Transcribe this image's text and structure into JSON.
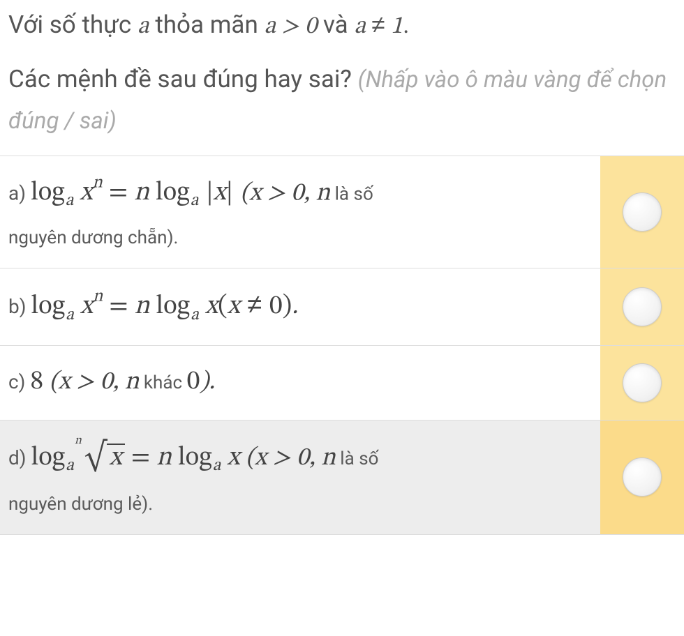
{
  "intro": {
    "pre": "Với số thực ",
    "a": "a",
    "mid": " thỏa mãn ",
    "cond1": "a > 0",
    "and": " và ",
    "cond2_a": "a",
    "cond2_neq": "≠",
    "cond2_one": "1",
    "period": "."
  },
  "sub": {
    "main": "Các mệnh đề sau đúng hay sai? ",
    "hint": "(Nhấp vào ô màu vàng để chọn đúng / sai)"
  },
  "options": {
    "a": {
      "label": "a) ",
      "log": "log",
      "sub": "a",
      "x": "x",
      "sup": "n",
      "eq": " = ",
      "n": "n",
      "log2": " log",
      "sub2": "a",
      "absx": "|x|",
      "open": " (",
      "cond": "x > 0",
      "comma": ", ",
      "nvar": "n",
      "note1": " là số",
      "note2": "nguyên dương chẵn).",
      "close": ""
    },
    "b": {
      "label": "b) ",
      "log": "log",
      "sub": "a",
      "x": "x",
      "sup": "n",
      "eq": " = ",
      "n": "n",
      "log2": " log",
      "sub2": "a",
      "x2": " x",
      "open": "(",
      "cond_x": "x",
      "neq": " ≠ ",
      "zero": "0",
      "close": ")",
      "period": "."
    },
    "c": {
      "label": "c) ",
      "eight": "8",
      "open": " (",
      "cond": "x > 0",
      "comma": ", ",
      "nvar": "n",
      "note": " khác ",
      "zero": "0",
      "close": ")."
    },
    "d": {
      "label": "d) ",
      "log": "log",
      "sub": "a",
      "root_index": "n",
      "root_rad": "x",
      "eq": " = ",
      "n": "n",
      "log2": " log",
      "sub2": "a",
      "x2": " x",
      "open": " (",
      "cond": "x > 0",
      "comma": ", ",
      "nvar": "n",
      "note1": " là số",
      "note2": "nguyên dương lẻ)."
    }
  }
}
